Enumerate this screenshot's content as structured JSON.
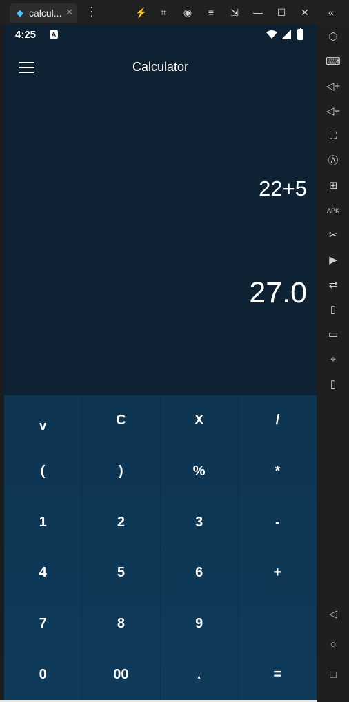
{
  "window": {
    "tab_title": "calcul...",
    "tab_close": "✕",
    "more": "⋮",
    "toolbar_icons": [
      "lightning-icon",
      "gamepad-icon",
      "account-icon",
      "hamburger-icon",
      "resize-icon",
      "minimize-icon",
      "maximize-icon",
      "close-icon",
      "collapse-icon"
    ],
    "toolbar_glyphs": [
      "⚡",
      "⌗",
      "◉",
      "≡",
      "⇲",
      "—",
      "☐",
      "✕",
      "«"
    ]
  },
  "sidebar": {
    "icons": [
      "hexagon-icon",
      "keyboard-icon",
      "volume-up-icon",
      "volume-down-icon",
      "screenshot-icon",
      "rotate-icon",
      "add-window-icon",
      "apk-icon",
      "cut-icon",
      "media-icon",
      "transfer-icon",
      "vibrate-icon",
      "folder-icon",
      "location-icon",
      "shake-icon",
      "back-icon",
      "home-icon",
      "recents-icon"
    ],
    "glyphs": [
      "⬡",
      "⌨",
      "◁+",
      "◁−",
      "⛶",
      "Ⓐ",
      "⊞",
      "APK",
      "✂",
      "▶",
      "⇄",
      "▯",
      "▭",
      "⌖",
      "▯",
      "◁",
      "○",
      "□"
    ]
  },
  "status": {
    "time": "4:25",
    "badge": "A"
  },
  "app": {
    "title": "Calculator",
    "expression": "22+5",
    "result": "27.0"
  },
  "keys": [
    "v",
    "C",
    "X",
    "/",
    "(",
    ")",
    "%",
    "*",
    "1",
    "2",
    "3",
    "-",
    "4",
    "5",
    "6",
    "+",
    "7",
    "8",
    "9",
    "",
    "0",
    "00",
    ".",
    "="
  ],
  "colors": {
    "screen": "#0f2233",
    "keypad": "#0e3552",
    "text": "#ffffff"
  }
}
